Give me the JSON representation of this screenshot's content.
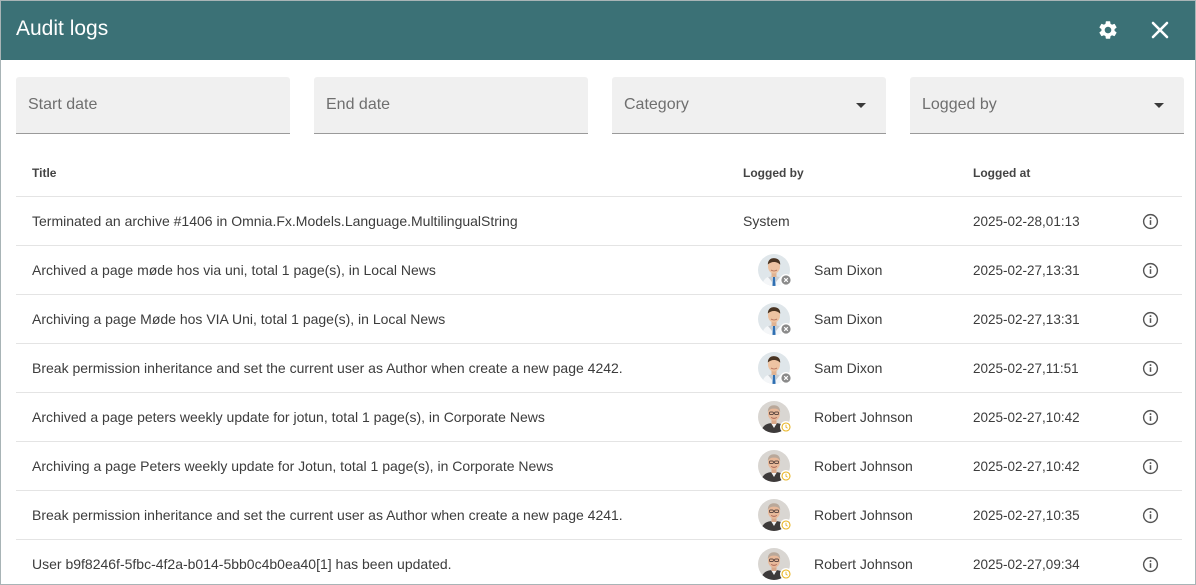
{
  "header": {
    "title": "Audit logs",
    "settings_icon": "gear-icon",
    "close_icon": "close-icon",
    "bg_color": "#3b7176"
  },
  "filters": {
    "start_date": {
      "placeholder": "Start date"
    },
    "end_date": {
      "placeholder": "End date"
    },
    "category": {
      "placeholder": "Category"
    },
    "logged_by": {
      "placeholder": "Logged by"
    }
  },
  "table": {
    "columns": {
      "title": "Title",
      "logged_by": "Logged by",
      "logged_at": "Logged at"
    },
    "rows": [
      {
        "title": "Terminated an archive #1406 in Omnia.Fx.Models.Language.MultilingualString",
        "logged_by": "System",
        "avatar": "",
        "status": "",
        "logged_at": "2025-02-28,01:13"
      },
      {
        "title": "Archived a page møde hos via uni, total 1 page(s), in Local News",
        "logged_by": "Sam Dixon",
        "avatar": "sam",
        "status": "offline",
        "logged_at": "2025-02-27,13:31"
      },
      {
        "title": "Archiving a page Møde hos VIA Uni, total 1 page(s), in Local News",
        "logged_by": "Sam Dixon",
        "avatar": "sam",
        "status": "offline",
        "logged_at": "2025-02-27,13:31"
      },
      {
        "title": "Break permission inheritance and set the current user as Author when create a new page 4242.",
        "logged_by": "Sam Dixon",
        "avatar": "sam",
        "status": "offline",
        "logged_at": "2025-02-27,11:51"
      },
      {
        "title": "Archived a page peters weekly update for jotun, total 1 page(s), in Corporate News",
        "logged_by": "Robert Johnson",
        "avatar": "robert",
        "status": "away",
        "logged_at": "2025-02-27,10:42"
      },
      {
        "title": "Archiving a page Peters weekly update for Jotun, total 1 page(s), in Corporate News",
        "logged_by": "Robert Johnson",
        "avatar": "robert",
        "status": "away",
        "logged_at": "2025-02-27,10:42"
      },
      {
        "title": "Break permission inheritance and set the current user as Author when create a new page 4241.",
        "logged_by": "Robert Johnson",
        "avatar": "robert",
        "status": "away",
        "logged_at": "2025-02-27,10:35"
      },
      {
        "title": "User b9f8246f-5fbc-4f2a-b014-5bb0c4b0ea40[1] has been updated.",
        "logged_by": "Robert Johnson",
        "avatar": "robert",
        "status": "away",
        "logged_at": "2025-02-27,09:34"
      }
    ]
  },
  "status_colors": {
    "offline": "#8a8a8a",
    "away": "#e8b423"
  }
}
